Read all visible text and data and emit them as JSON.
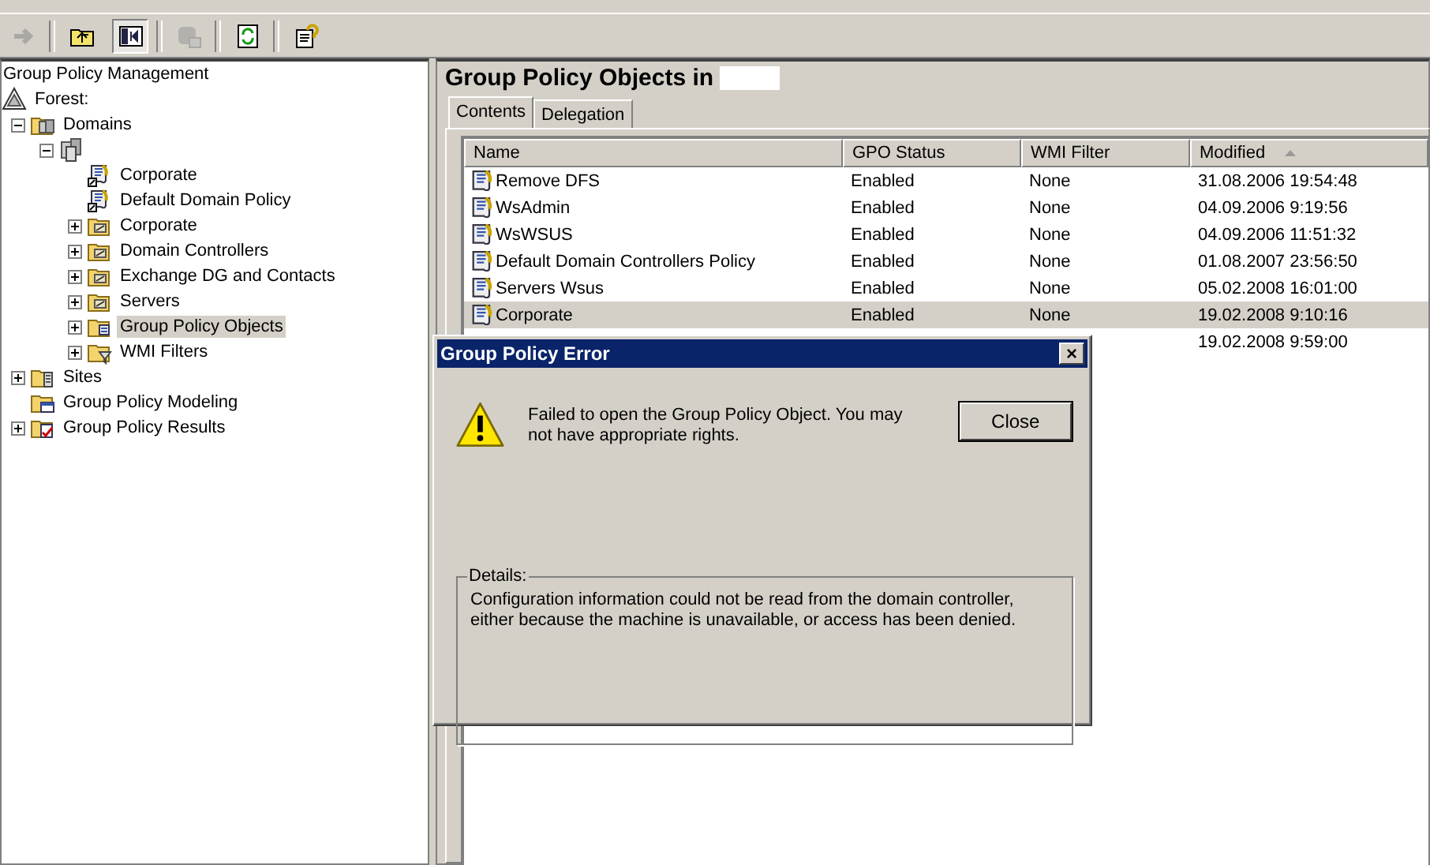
{
  "toolbar": [
    {
      "kind": "back",
      "disabled": true
    },
    {
      "kind": "up",
      "disabled": false
    },
    {
      "kind": "tree",
      "pressed": true
    },
    {
      "kind": "export",
      "disabled": true
    },
    {
      "kind": "refresh",
      "disabled": false
    },
    {
      "kind": "help",
      "disabled": false
    }
  ],
  "tree": {
    "label": "Group Policy Management",
    "children": [
      {
        "label": "Forest:",
        "kind": "forest",
        "selected": false,
        "children": [
          {
            "label": "Domains",
            "kind": "domains",
            "expanded": true,
            "selected": false,
            "children": [
              {
                "kind": "domain",
                "expanded": true,
                "children": [
                  {
                    "label": "Corporate",
                    "kind": "gpo-link",
                    "selected": false
                  },
                  {
                    "label": "Default Domain Policy",
                    "kind": "gpo-link",
                    "selected": false
                  },
                  {
                    "label": "Corporate",
                    "kind": "ou",
                    "expanded": false,
                    "selected": false
                  },
                  {
                    "label": "Domain Controllers",
                    "kind": "ou",
                    "expanded": false,
                    "selected": false
                  },
                  {
                    "label": "Exchange DG and Contacts",
                    "kind": "ou",
                    "expanded": false,
                    "selected": false
                  },
                  {
                    "label": "Servers",
                    "kind": "ou",
                    "expanded": false,
                    "selected": false
                  },
                  {
                    "label": "Group Policy Objects",
                    "kind": "gpo-folder",
                    "expanded": false,
                    "selected": true
                  },
                  {
                    "label": "WMI Filters",
                    "kind": "wmi-folder",
                    "expanded": false,
                    "selected": false
                  }
                ]
              }
            ]
          },
          {
            "label": "Sites",
            "kind": "sites",
            "expanded": false,
            "selected": false
          },
          {
            "label": "Group Policy Modeling",
            "kind": "modeling",
            "selected": false
          },
          {
            "label": "Group Policy Results",
            "kind": "results",
            "expanded": false,
            "selected": false
          }
        ]
      }
    ]
  },
  "content": {
    "title": "Group Policy Objects in",
    "tabs": [
      {
        "label": "Contents",
        "selected": true
      },
      {
        "label": "Delegation",
        "selected": false
      }
    ],
    "table": {
      "columns": [
        {
          "label": "Name",
          "sorted": false
        },
        {
          "label": "GPO Status",
          "sorted": false
        },
        {
          "label": "WMI Filter",
          "sorted": false
        },
        {
          "label": "Modified",
          "sorted": true
        }
      ],
      "rows": [
        {
          "name": "Remove DFS",
          "status": "Enabled",
          "wmi_filter": "None",
          "modified": "31.08.2006 19:54:48",
          "selected": false
        },
        {
          "name": "WsAdmin",
          "status": "Enabled",
          "wmi_filter": "None",
          "modified": "04.09.2006 9:19:56",
          "selected": false
        },
        {
          "name": "WsWSUS",
          "status": "Enabled",
          "wmi_filter": "None",
          "modified": "04.09.2006 11:51:32",
          "selected": false
        },
        {
          "name": "Default Domain Controllers Policy",
          "status": "Enabled",
          "wmi_filter": "None",
          "modified": "01.08.2007 23:56:50",
          "selected": false
        },
        {
          "name": "Servers Wsus",
          "status": "Enabled",
          "wmi_filter": "None",
          "modified": "05.02.2008 16:01:00",
          "selected": false
        },
        {
          "name": "Corporate",
          "status": "Enabled",
          "wmi_filter": "None",
          "modified": "19.02.2008 9:10:16",
          "selected": true
        },
        {
          "modified": "19.02.2008 9:59:00",
          "selected": false
        }
      ]
    }
  },
  "dialog": {
    "title": "Group Policy Error",
    "message": "Failed to open the Group Policy Object.  You may not have appropriate rights.",
    "button": "Close",
    "close_glyph": "×",
    "details_label": "Details:",
    "details": "Configuration information could not be read from the domain controller, either because the machine is unavailable, or access has been denied."
  }
}
